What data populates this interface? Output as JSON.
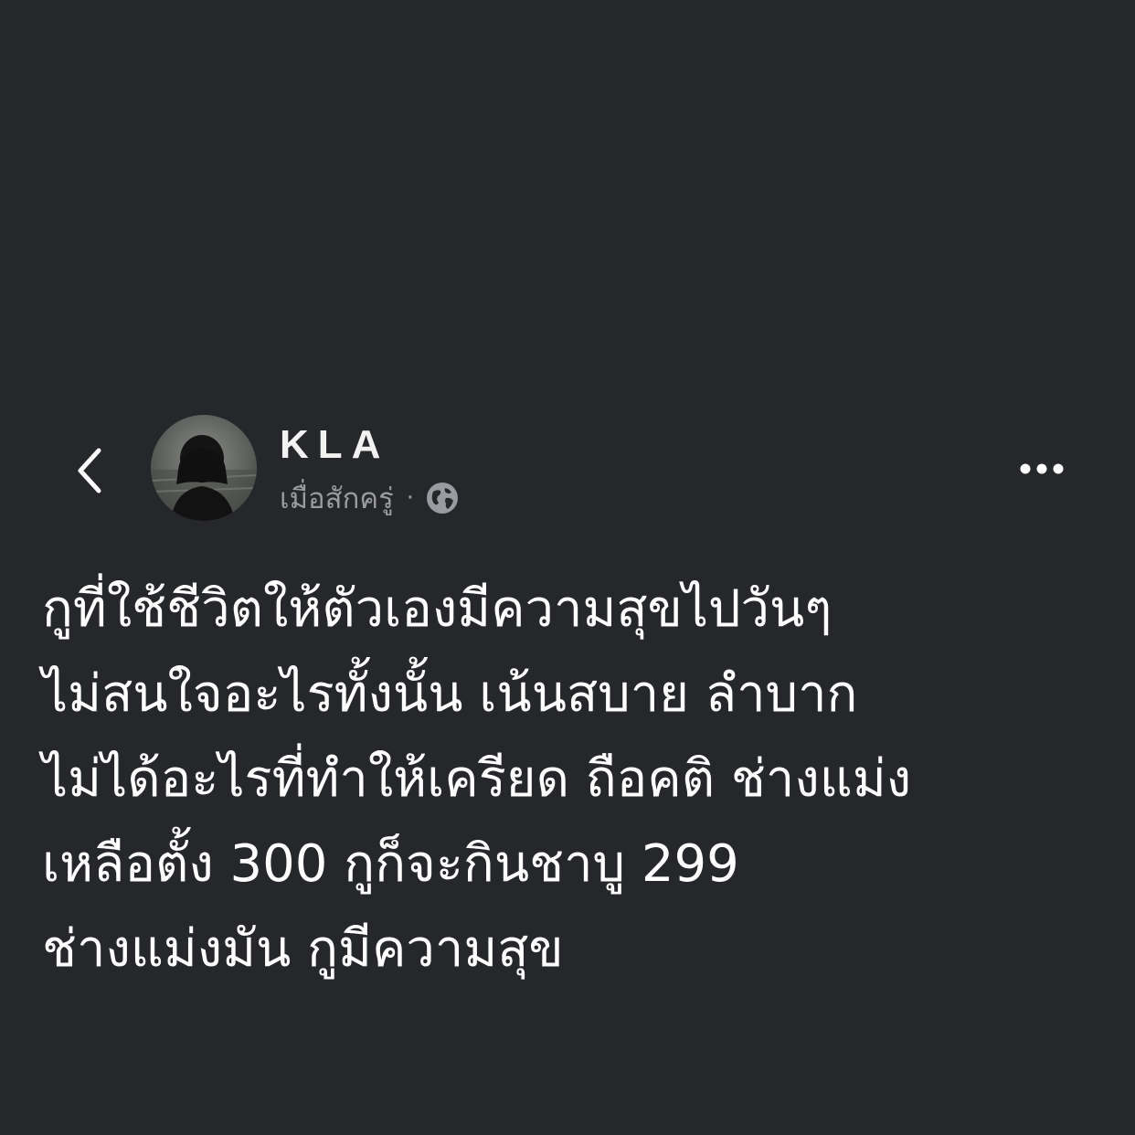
{
  "post": {
    "author": "KLA",
    "timestamp": "เมื่อสักครู่",
    "separator": "·",
    "privacy_icon": "globe-icon",
    "lines": [
      "กูที่ใช้ชีวิตให้ตัวเองมีความสุขไปวันๆ",
      "ไม่สนใจอะไรทั้งนั้น เน้นสบาย ลำบาก",
      "ไม่ได้อะไรที่ทำให้เครียด ถือคติ ช่างแม่ง",
      "เหลือตั้ง 300 กูก็จะกินชาบู 299",
      "ช่างแม่งมัน กูมีความสุข"
    ]
  },
  "icons": {
    "back": "chevron-left-icon",
    "more": "more-horizontal-icon"
  },
  "colors": {
    "background": "#26272b",
    "text": "#ffffff",
    "meta": "#9a9ba0"
  }
}
